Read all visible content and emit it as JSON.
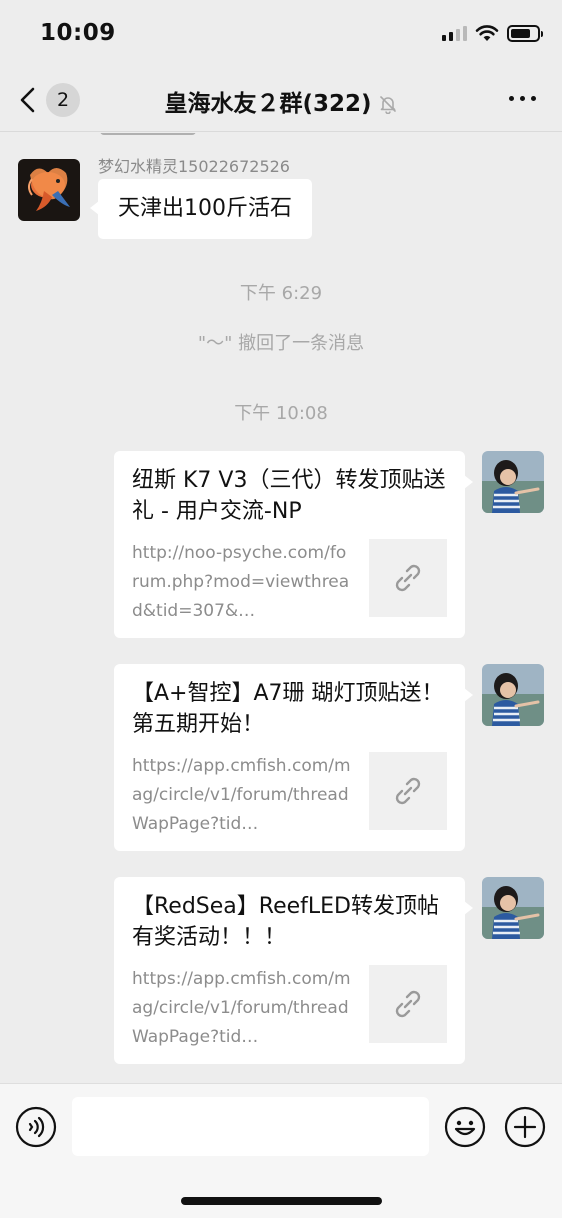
{
  "status_bar": {
    "time": "10:09",
    "signal_icon": "cellular-signal-icon",
    "wifi_icon": "wifi-icon",
    "battery_icon": "battery-icon"
  },
  "nav": {
    "back_icon": "chevron-left-icon",
    "unread_count": "2",
    "title": "皇海水友２群(322)",
    "mute_icon": "bell-slash-icon",
    "more_icon": "more-dots-icon"
  },
  "messages": {
    "incoming": {
      "sender": "梦幻水精灵15022672526",
      "text": "天津出100斤活石",
      "avatar_icon": "fish-avatar"
    },
    "time_1": "下午 6:29",
    "recall_notice": "\"～\" 撤回了一条消息",
    "time_2": "下午 10:08",
    "link_cards": [
      {
        "title": "纽斯 K7 V3（三代）转发顶贴送礼 - 用户交流-NP",
        "url": "http://noo-psyche.com/forum.php?mod=viewthread&tid=307&…",
        "thumb_icon": "link-icon"
      },
      {
        "title": "【A+智控】A7珊 瑚灯顶贴送！第五期开始！",
        "url": "https://app.cmfish.com/mag/circle/v1/forum/threadWapPage?tid…",
        "thumb_icon": "link-icon"
      },
      {
        "title": "【RedSea】ReefLED转发顶帖有奖活动！！！",
        "url": "https://app.cmfish.com/mag/circle/v1/forum/threadWapPage?tid…",
        "thumb_icon": "link-icon"
      }
    ]
  },
  "input_bar": {
    "voice_icon": "voice-icon",
    "input_value": "",
    "emoji_icon": "emoji-icon",
    "plus_icon": "plus-icon"
  },
  "colors": {
    "background": "#ededed",
    "bubble": "#ffffff",
    "meta_text": "#a8a8a8"
  }
}
